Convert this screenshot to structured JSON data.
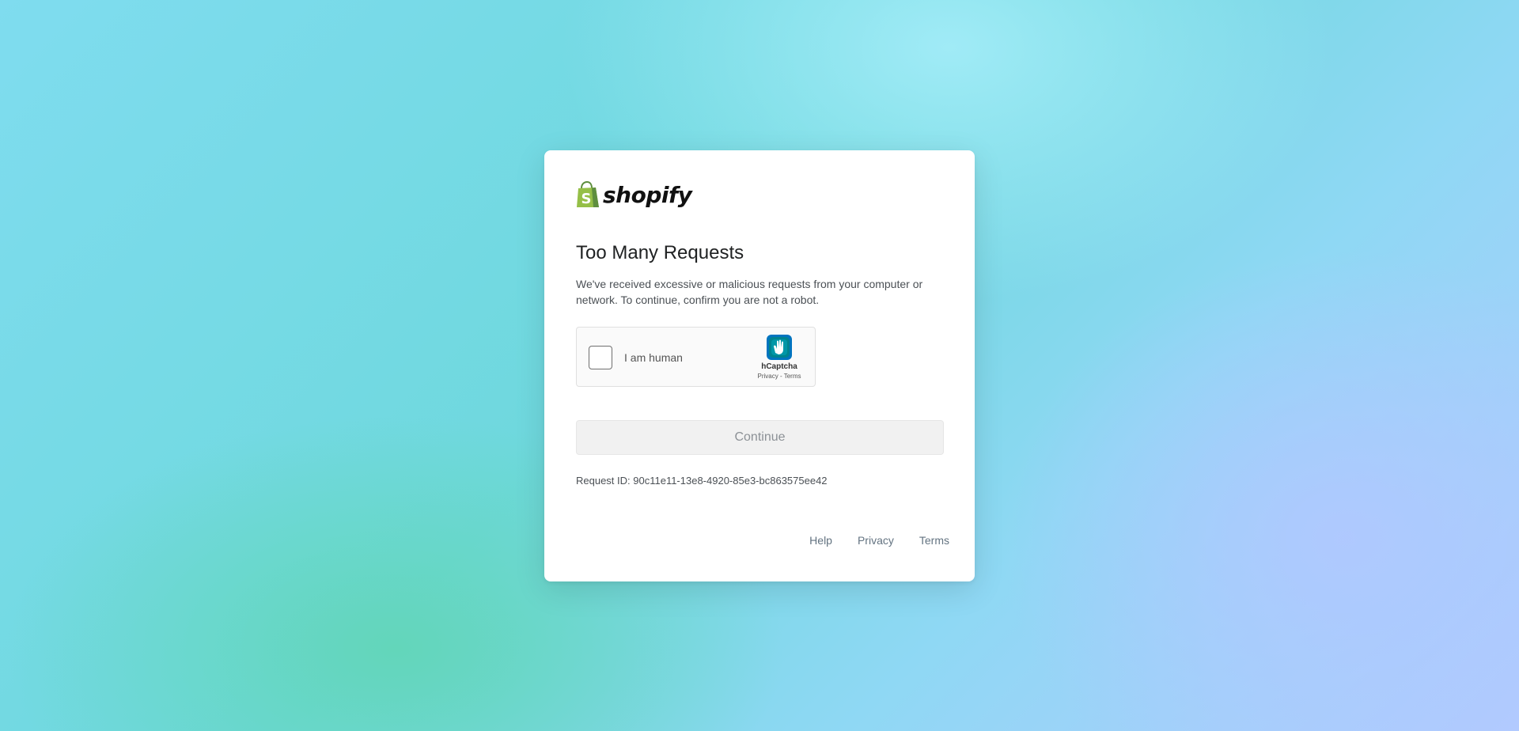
{
  "brand": {
    "name": "shopify",
    "accent": "#95bf47",
    "accent_dark": "#5e8e3e"
  },
  "main": {
    "title": "Too Many Requests",
    "description": "We've received excessive or malicious requests from your computer or network. To continue, confirm you are not a robot.",
    "request_id": "Request ID: 90c11e11-13e8-4920-85e3-bc863575ee42"
  },
  "captcha": {
    "label": "I am human",
    "brand": "hCaptcha",
    "privacy_label": "Privacy",
    "separator": " - ",
    "terms_label": "Terms",
    "checked": false,
    "logo_icon": "hcaptcha-hand-icon"
  },
  "actions": {
    "continue_label": "Continue",
    "continue_disabled": true
  },
  "footer": {
    "links": [
      "Help",
      "Privacy",
      "Terms"
    ]
  }
}
